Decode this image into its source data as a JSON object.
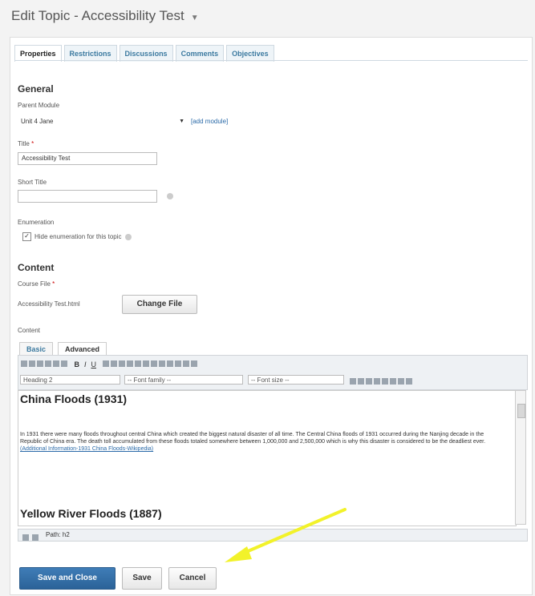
{
  "header": {
    "title": "Edit Topic - Accessibility Test"
  },
  "tabs": [
    {
      "label": "Properties"
    },
    {
      "label": "Restrictions"
    },
    {
      "label": "Discussions"
    },
    {
      "label": "Comments"
    },
    {
      "label": "Objectives"
    }
  ],
  "general": {
    "heading": "General",
    "parent_module_label": "Parent Module",
    "parent_module_value": "Unit 4 Jane",
    "add_module_link": "[add module]",
    "title_label": "Title",
    "title_value": "Accessibility Test",
    "short_title_label": "Short Title",
    "short_title_value": "",
    "enumeration_label": "Enumeration",
    "enumeration_checkbox_label": "Hide enumeration for this topic",
    "enumeration_checked": true
  },
  "content": {
    "heading": "Content",
    "course_file_label": "Course File",
    "file_name": "Accessibility Test.html",
    "change_file_button": "Change File",
    "content_label": "Content"
  },
  "editor": {
    "tab_basic": "Basic",
    "tab_advanced": "Advanced",
    "format_select": "Heading 2",
    "font_family_select": "-- Font family --",
    "font_size_select": "-- Font size --",
    "heading1": "China Floods (1931)",
    "para1": "In 1931 there were many floods throughout central China which created the biggest natural disaster of all time. The Central China floods of 1931 occurred during the Nanjing decade in the Republic of China era. The death toll accumulated from these floods totaled somewhere between 1,000,000 and 2,500,000 which is why this disaster is considered to be the deadliest ever.",
    "para1_link": "(Additional Information-1931 China Floods-Wikipedia)",
    "heading2": "Yellow River Floods (1887)",
    "path": "Path: h2"
  },
  "buttons": {
    "save_close": "Save and Close",
    "save": "Save",
    "cancel": "Cancel"
  },
  "annotation": {
    "arrow_color": "#f2f22a"
  }
}
